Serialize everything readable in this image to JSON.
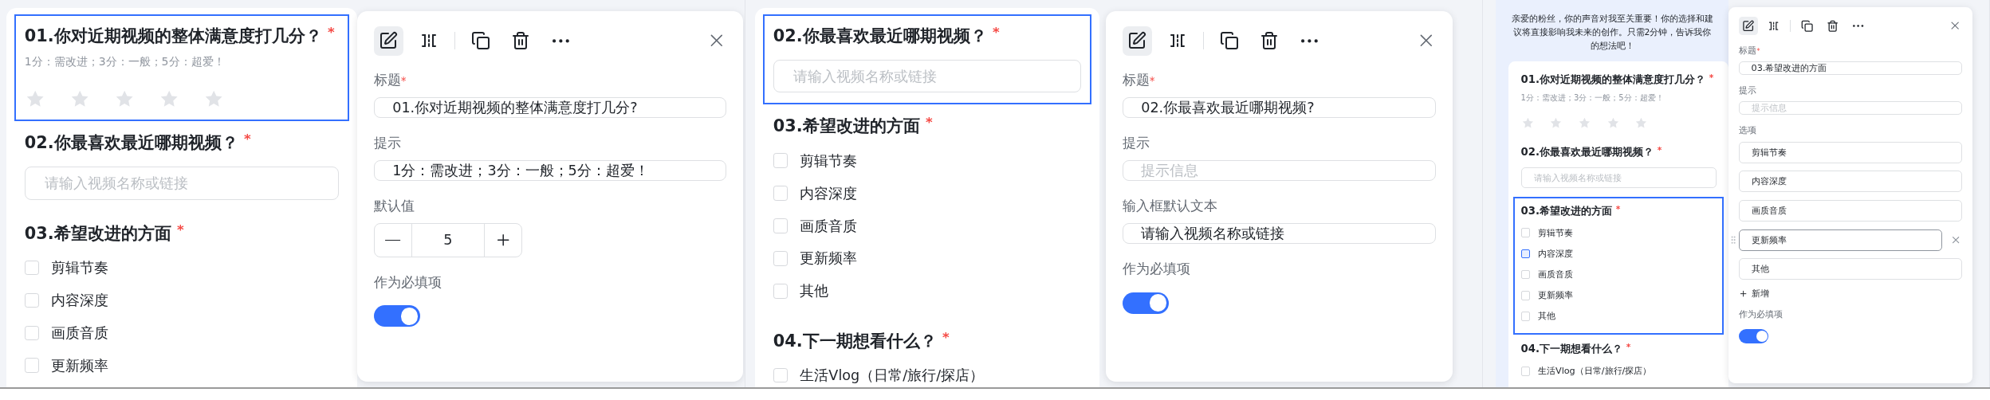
{
  "screens": [
    {
      "form": {
        "questions": [
          {
            "kind": "rating",
            "title": "01.你对近期视频的整体满意度打几分？",
            "required_mark": "*",
            "selected": true,
            "hint": "1分：需改进；3分：一般；5分：超爱！",
            "stars": 0
          },
          {
            "kind": "text",
            "title": "02.你最喜欢最近哪期视频？",
            "required_mark": "*",
            "selected": false,
            "placeholder": "请输入视频名称或链接"
          },
          {
            "kind": "checkbox",
            "title": "03.希望改进的方面",
            "required_mark": "*",
            "selected": false,
            "options": [
              {
                "label": "剪辑节奏",
                "highlighted": false
              },
              {
                "label": "内容深度",
                "highlighted": false
              },
              {
                "label": "画质音质",
                "highlighted": false
              },
              {
                "label": "更新频率",
                "highlighted": false
              }
            ]
          }
        ]
      },
      "editor": {
        "tools": [
          {
            "kind": "edit",
            "selected": true
          },
          {
            "kind": "split",
            "selected": false
          },
          {
            "kind": "copy",
            "selected": false
          },
          {
            "kind": "delete",
            "selected": false
          },
          {
            "kind": "more",
            "selected": false
          }
        ],
        "fields": [
          {
            "kind": "text",
            "label": "标题",
            "required_mark": "*",
            "value": "01.你对近期视频的整体满意度打几分?"
          },
          {
            "kind": "text",
            "label": "提示",
            "value": "1分：需改进；3分：一般；5分：超爱！"
          },
          {
            "kind": "stepper",
            "label": "默认值",
            "value": "5"
          },
          {
            "kind": "switch",
            "label": "作为必填项",
            "on": true
          }
        ]
      }
    },
    {
      "form": {
        "questions": [
          {
            "kind": "text",
            "title": "02.你最喜欢最近哪期视频？",
            "required_mark": "*",
            "selected": true,
            "placeholder": "请输入视频名称或链接"
          },
          {
            "kind": "checkbox",
            "title": "03.希望改进的方面",
            "required_mark": "*",
            "selected": false,
            "options": [
              {
                "label": "剪辑节奏",
                "highlighted": false
              },
              {
                "label": "内容深度",
                "highlighted": false
              },
              {
                "label": "画质音质",
                "highlighted": false
              },
              {
                "label": "更新频率",
                "highlighted": false
              },
              {
                "label": "其他",
                "highlighted": false
              }
            ]
          },
          {
            "kind": "checkbox",
            "title": "04.下一期想看什么？",
            "required_mark": "*",
            "selected": false,
            "options": [
              {
                "label": "生活Vlog（日常/旅行/探店）",
                "highlighted": false
              }
            ]
          }
        ]
      },
      "editor": {
        "tools": [
          {
            "kind": "edit",
            "selected": true
          },
          {
            "kind": "split",
            "selected": false
          },
          {
            "kind": "copy",
            "selected": false
          },
          {
            "kind": "delete",
            "selected": false
          },
          {
            "kind": "more",
            "selected": false
          }
        ],
        "fields": [
          {
            "kind": "text",
            "label": "标题",
            "required_mark": "*",
            "value": "02.你最喜欢最近哪期视频?"
          },
          {
            "kind": "text",
            "label": "提示",
            "placeholder": "提示信息"
          },
          {
            "kind": "text",
            "label": "输入框默认文本",
            "value": "请输入视频名称或链接"
          },
          {
            "kind": "switch",
            "label": "作为必填项",
            "on": true
          }
        ]
      }
    },
    {
      "form": {
        "intro": "亲爱的粉丝，你的声音对我至关重要！你的选择和建议将直接影响我未来的创作。只需2分钟，告诉我你的想法吧！",
        "questions": [
          {
            "kind": "rating",
            "title": "01.你对近期视频的整体满意度打几分？",
            "required_mark": "*",
            "selected": false,
            "hint": "1分：需改进；3分：一般；5分：超爱！",
            "stars": 0
          },
          {
            "kind": "text",
            "title": "02.你最喜欢最近哪期视频？",
            "required_mark": "*",
            "selected": false,
            "placeholder": "请输入视频名称或链接"
          },
          {
            "kind": "checkbox",
            "title": "03.希望改进的方面",
            "required_mark": "*",
            "selected": true,
            "options": [
              {
                "label": "剪辑节奏",
                "highlighted": false
              },
              {
                "label": "内容深度",
                "highlighted": true
              },
              {
                "label": "画质音质",
                "highlighted": false
              },
              {
                "label": "更新频率",
                "highlighted": false
              },
              {
                "label": "其他",
                "highlighted": false
              }
            ]
          },
          {
            "kind": "checkbox",
            "title": "04.下一期想看什么？",
            "required_mark": "*",
            "selected": false,
            "options": [
              {
                "label": "生活Vlog（日常/旅行/探店）",
                "highlighted": false
              }
            ]
          }
        ]
      },
      "editor": {
        "tools": [
          {
            "kind": "edit",
            "selected": true
          },
          {
            "kind": "split",
            "selected": false
          },
          {
            "kind": "copy",
            "selected": false
          },
          {
            "kind": "delete",
            "selected": false
          },
          {
            "kind": "more",
            "selected": false
          }
        ],
        "fields": [
          {
            "kind": "text",
            "label": "标题",
            "required_mark": "*",
            "value": "03.希望改进的方面"
          },
          {
            "kind": "text",
            "label": "提示",
            "placeholder": "提示信息"
          },
          {
            "kind": "options",
            "label": "选项",
            "options": [
              {
                "value": "剪辑节奏",
                "focused": false
              },
              {
                "value": "内容深度",
                "focused": false
              },
              {
                "value": "画质音质",
                "focused": false
              },
              {
                "value": "更新频率",
                "focused": true
              },
              {
                "value": "其他",
                "focused": false
              }
            ],
            "add_label": "新增"
          },
          {
            "kind": "switch",
            "label": "作为必填项",
            "on": true
          }
        ]
      }
    }
  ]
}
